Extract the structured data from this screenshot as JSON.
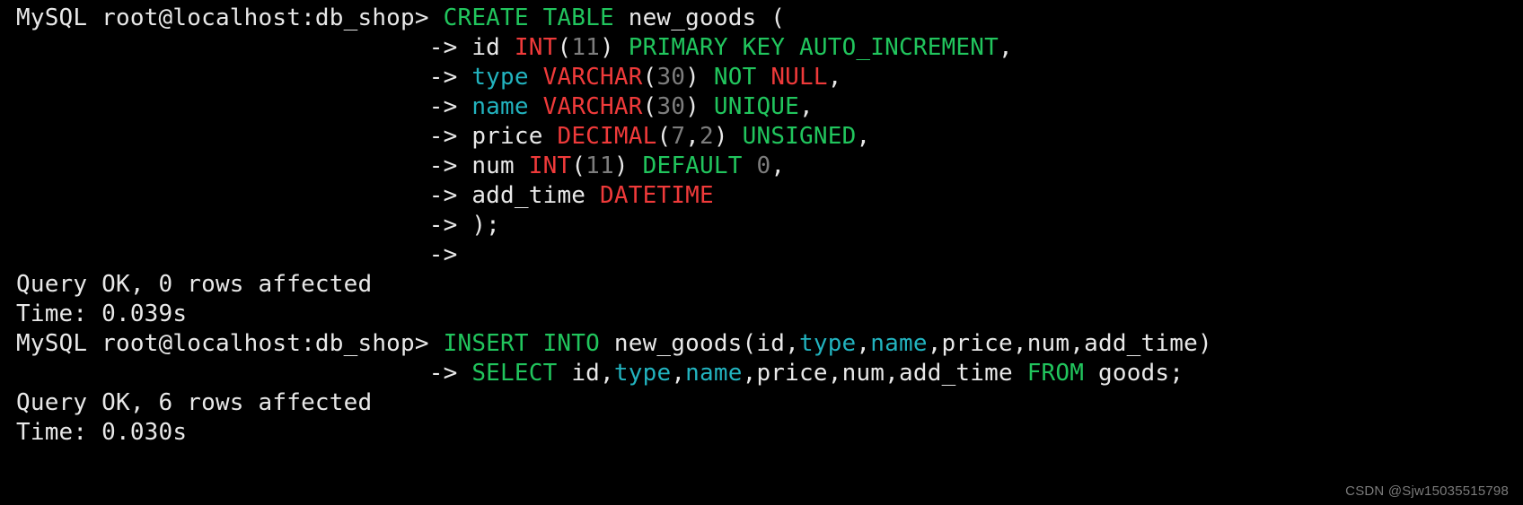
{
  "prompt1_user": "MySQL root@localhost:db_shop>",
  "cont_arrow": "->",
  "stmt1": {
    "create_table": "CREATE TABLE",
    "table_name": "new_goods",
    "lparen": "(",
    "id": {
      "col": "id",
      "int": "INT",
      "lp": "(",
      "n": "11",
      "rp": ")",
      "pk": "PRIMARY KEY",
      "ai": "AUTO_INCREMENT",
      "comma": ","
    },
    "type_col": {
      "col": "type",
      "varchar": "VARCHAR",
      "lp": "(",
      "n": "30",
      "rp": ")",
      "not_kw": "NOT",
      "null_kw": "NULL",
      "comma": ","
    },
    "name_col": {
      "col": "name",
      "varchar": "VARCHAR",
      "lp": "(",
      "n": "30",
      "rp": ")",
      "unique": "UNIQUE",
      "comma": ","
    },
    "price_col": {
      "col": "price",
      "decimal": "DECIMAL",
      "lp": "(",
      "n1": "7",
      "c": ",",
      "n2": "2",
      "rp": ")",
      "unsigned": "UNSIGNED",
      "comma": ","
    },
    "num_col": {
      "col": "num",
      "int": "INT",
      "lp": "(",
      "n": "11",
      "rp": ")",
      "default": "DEFAULT",
      "zero": "0",
      "comma": ","
    },
    "addtime_col": {
      "col": "add_time",
      "datetime": "DATETIME"
    },
    "close": ");"
  },
  "result1_line1": "Query OK, 0 rows affected",
  "result1_line2": "Time: 0.039s",
  "prompt2_user": "MySQL root@localhost:db_shop>",
  "stmt2": {
    "insert_into": "INSERT INTO",
    "table": "new_goods",
    "lp": "(",
    "cols": {
      "id": "id",
      "type": "type",
      "name": "name",
      "price": "price",
      "num": "num",
      "add_time": "add_time"
    },
    "rp": ")",
    "select": "SELECT",
    "sel_cols": {
      "id": "id",
      "type": "type",
      "name": "name",
      "price": "price",
      "num": "num",
      "add_time": "add_time"
    },
    "from": "FROM",
    "src": "goods",
    "semi": ";"
  },
  "result2_line1": "Query OK, 6 rows affected",
  "result2_line2": "Time: 0.030s",
  "watermark": "CSDN @Sjw15035515798"
}
